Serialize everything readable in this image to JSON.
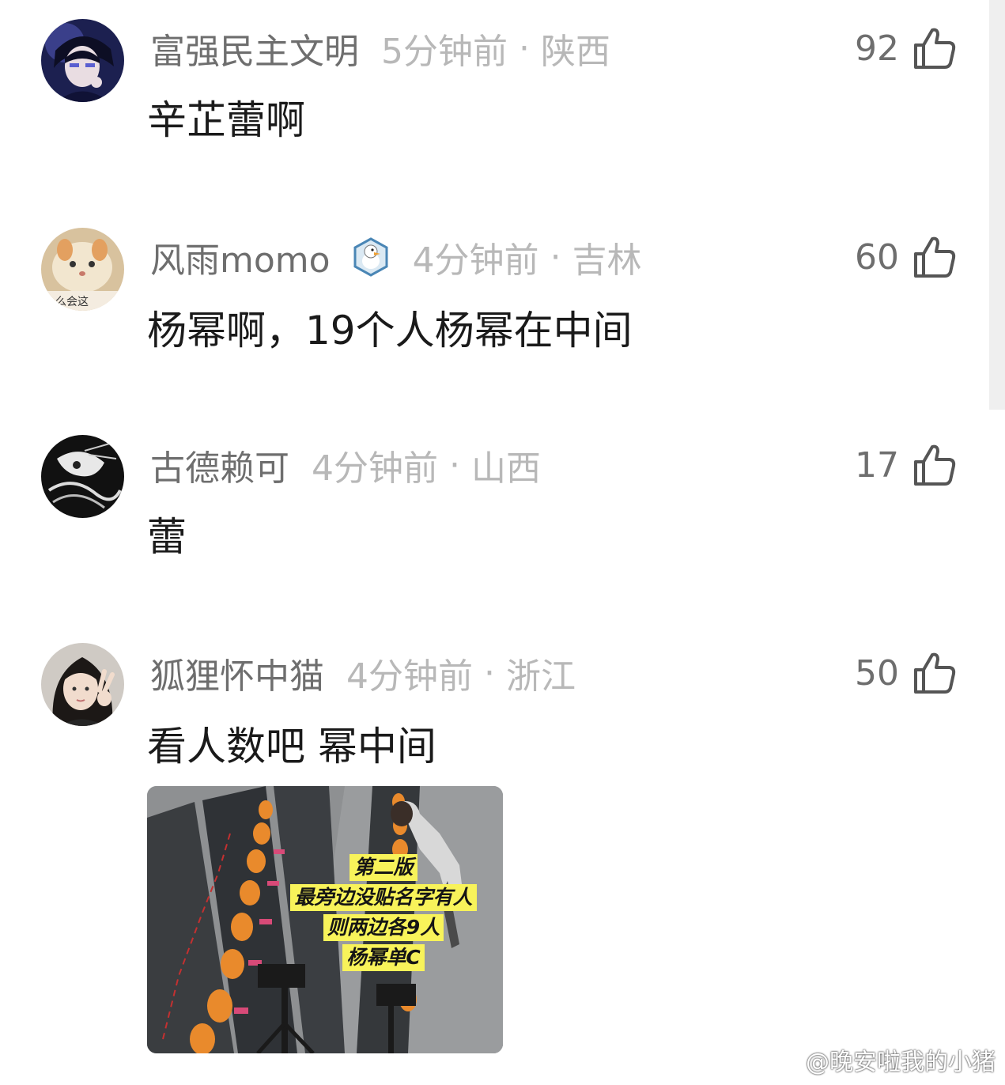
{
  "comments": [
    {
      "username": "富强民主文明",
      "time": "5分钟前",
      "separator": "·",
      "location": "陕西",
      "text": "辛芷蕾啊",
      "likes": "92",
      "avatar_icon": "anime-boy-avatar",
      "has_badge": false
    },
    {
      "username": "风雨momo",
      "time": "4分钟前",
      "separator": "·",
      "location": "吉林",
      "text": "杨幂啊，19个人杨幂在中间",
      "likes": "60",
      "avatar_icon": "cat-avatar",
      "avatar_caption": "么会这",
      "has_badge": true,
      "badge_icon": "duck-badge-icon"
    },
    {
      "username": "古德赖可",
      "time": "4分钟前",
      "separator": "·",
      "location": "山西",
      "text": "蕾",
      "likes": "17",
      "avatar_icon": "bw-sketch-avatar",
      "has_badge": false
    },
    {
      "username": "狐狸怀中猫",
      "time": "4分钟前",
      "separator": "·",
      "location": "浙江",
      "text": "看人数吧 幂中间",
      "likes": "50",
      "avatar_icon": "girl-peace-sign-avatar",
      "has_badge": false,
      "image": {
        "label_lines": [
          "第二版",
          "最旁边没贴名字有人",
          "则两边各9人",
          "杨幂单C"
        ],
        "label_color": "#f8f35a"
      }
    }
  ],
  "watermark": {
    "text": "@晚安啦我的小猪",
    "icon": "weibo-icon"
  },
  "colors": {
    "username": "#6e6e6e",
    "meta_light": "#b8b8b8",
    "comment_text": "#1a1a1a",
    "background": "#ffffff"
  }
}
